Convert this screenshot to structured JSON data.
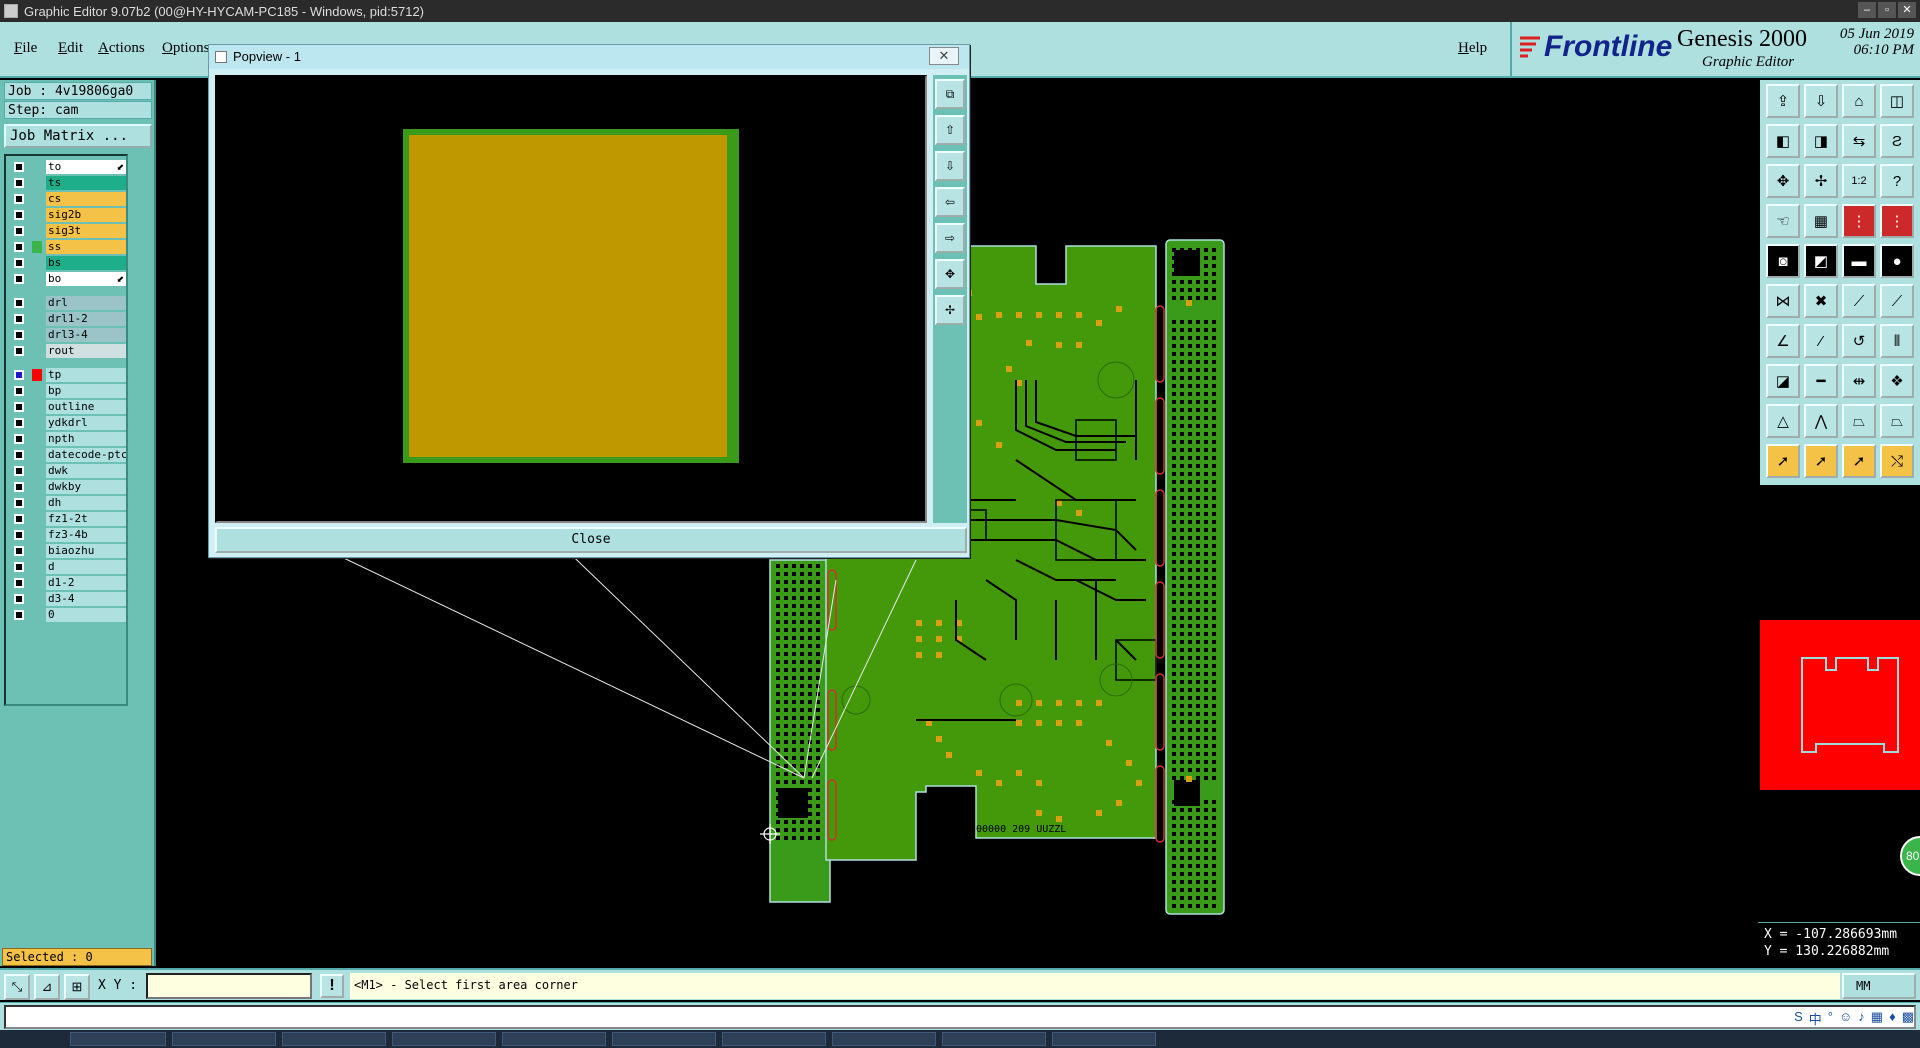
{
  "window": {
    "title": "Graphic Editor 9.07b2 (00@HY-HYCAM-PC185 - Windows, pid:5712)",
    "controls": [
      "–",
      "▫",
      "✕"
    ]
  },
  "menu": {
    "items": [
      "File",
      "Edit",
      "Actions",
      "Options"
    ],
    "help": "Help"
  },
  "brand": {
    "logo": "Frontline",
    "product": "Genesis 2000",
    "subtitle": "Graphic Editor",
    "date": "05 Jun 2019",
    "time": "06:10 PM"
  },
  "job": {
    "job_line": "Job : 4v19806ga0",
    "step_line": "Step: cam",
    "matrix_button": "Job Matrix ..."
  },
  "layers": [
    {
      "name": "to",
      "color": "#ffffff",
      "arrow": true
    },
    {
      "name": "ts",
      "color": "#1fae8a"
    },
    {
      "name": "cs",
      "color": "#f5c248"
    },
    {
      "name": "sig2b",
      "color": "#f5c248"
    },
    {
      "name": "sig3t",
      "color": "#f5c248"
    },
    {
      "name": "ss",
      "color": "#f5c248",
      "mark": "#3ab54a"
    },
    {
      "name": "bs",
      "color": "#1fae8a"
    },
    {
      "name": "bo",
      "color": "#ffffff",
      "arrow": true
    },
    {
      "name": "drl",
      "color": "#9ac4c8",
      "gap": true
    },
    {
      "name": "drl1-2",
      "color": "#9ac4c8"
    },
    {
      "name": "drl3-4",
      "color": "#9ac4c8"
    },
    {
      "name": "rout",
      "color": "#d0e0e0"
    },
    {
      "name": "tp",
      "color": "#aee0e0",
      "mark": "#ff0000",
      "gap": true,
      "active": true
    },
    {
      "name": "bp",
      "color": "#aee0e0"
    },
    {
      "name": "outline",
      "color": "#aee0e0"
    },
    {
      "name": "ydkdrl",
      "color": "#aee0e0"
    },
    {
      "name": "npth",
      "color": "#aee0e0"
    },
    {
      "name": "datecode-ptc",
      "color": "#aee0e0"
    },
    {
      "name": "dwk",
      "color": "#aee0e0"
    },
    {
      "name": "dwkby",
      "color": "#aee0e0"
    },
    {
      "name": "dh",
      "color": "#aee0e0"
    },
    {
      "name": "fz1-2t",
      "color": "#aee0e0"
    },
    {
      "name": "fz3-4b",
      "color": "#aee0e0"
    },
    {
      "name": "biaozhu",
      "color": "#aee0e0"
    },
    {
      "name": "d",
      "color": "#aee0e0"
    },
    {
      "name": "d1-2",
      "color": "#aee0e0"
    },
    {
      "name": "d3-4",
      "color": "#aee0e0"
    },
    {
      "name": "0",
      "color": "#aee0e0"
    }
  ],
  "status": {
    "selected": "Selected : 0"
  },
  "popview": {
    "title": "Popview - 1",
    "close_button": "Close",
    "close_x": "✕"
  },
  "command": {
    "xy_label": "X Y :",
    "xy_value": "",
    "prompt": "<M1> - Select first area corner",
    "units": "MM",
    "exclaim": "!"
  },
  "readout": {
    "x": "X = -107.286693mm",
    "y": "Y = 130.226882mm"
  },
  "board_text": "00000 209 UUZZL",
  "badge": "80",
  "ratio_tool": "1:2",
  "help_tool": "?"
}
